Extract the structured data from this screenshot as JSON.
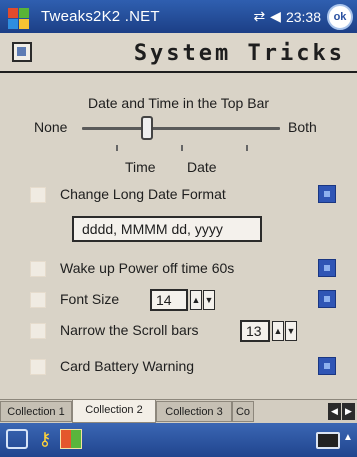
{
  "titlebar": {
    "app_title": "Tweaks2K2 .NET",
    "clock": "23:38",
    "ok_label": "ok",
    "icons": [
      "windows-logo",
      "network-connectivity",
      "volume",
      "ok"
    ]
  },
  "header": {
    "title": "System Tricks",
    "icon": "settings-page"
  },
  "content": {
    "date_time_heading": "Date and Time in the Top Bar",
    "slider": {
      "min_label": "None",
      "max_label": "Both",
      "level": 0.33,
      "tick_labels": [
        "Time",
        "Date"
      ]
    },
    "options": [
      {
        "label": "Change Long Date Format",
        "checked": false,
        "has_info": true
      },
      {
        "label": "Wake up Power off time 60s",
        "checked": false,
        "has_info": true
      },
      {
        "label": "Font Size",
        "checked": false,
        "has_info": true
      },
      {
        "label": "Narrow the Scroll bars",
        "checked": false,
        "has_info": false
      },
      {
        "label": "Card Battery Warning",
        "checked": false,
        "has_info": true
      }
    ],
    "date_format_value": "dddd, MMMM dd, yyyy",
    "font_size_value": "14",
    "scroll_bar_value": "13"
  },
  "tabs": {
    "items": [
      "Collection 1",
      "Collection 2",
      "Collection 3",
      "Co"
    ],
    "active_index": 1
  },
  "colors": {
    "titlebar": "#1c3f86",
    "accent": "#2f55b5",
    "background": "#d9d3c7"
  }
}
